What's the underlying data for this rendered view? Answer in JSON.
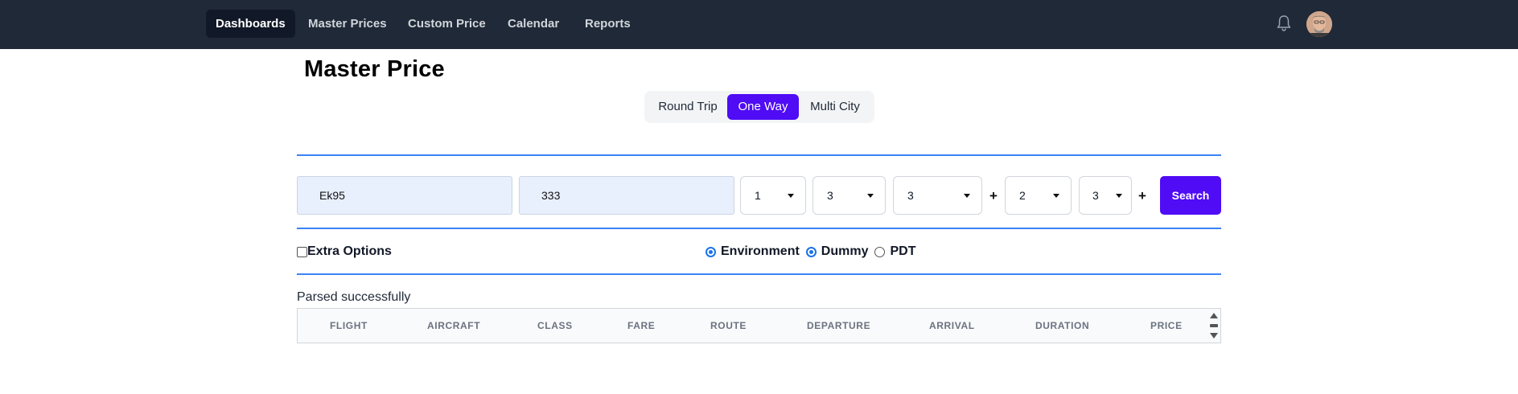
{
  "nav": {
    "items": [
      {
        "label": "Dashboards",
        "active": true
      },
      {
        "label": "Master Prices",
        "active": false
      },
      {
        "label": "Custom Price",
        "active": false
      },
      {
        "label": "Calendar",
        "active": false
      },
      {
        "label": "Reports",
        "active": false
      }
    ],
    "icons": [
      "bell-icon",
      "avatar"
    ]
  },
  "page": {
    "title": "Master Price"
  },
  "trip_type": {
    "options": [
      "Round Trip",
      "One Way",
      "Multi City"
    ],
    "selected": "One Way"
  },
  "search": {
    "field1_value": "Ek95",
    "field2_value": "333",
    "select1": "1",
    "select2": "3",
    "select3": "3",
    "plus1": "+",
    "select4": "2",
    "select5": "3",
    "plus2": "+",
    "button_label": "Search"
  },
  "options": {
    "extra_label": "Extra Options",
    "extra_checked": false,
    "radios": [
      {
        "label": "Environment",
        "checked": true
      },
      {
        "label": "Dummy",
        "checked": true
      },
      {
        "label": "PDT",
        "checked": false
      }
    ]
  },
  "status": {
    "message": "Parsed successfully"
  },
  "table": {
    "columns": [
      "FLIGHT",
      "AIRCRAFT",
      "CLASS",
      "FARE",
      "ROUTE",
      "DEPARTURE",
      "ARRIVAL",
      "DURATION",
      "PRICE"
    ],
    "rows": []
  },
  "colors": {
    "nav_bg": "#1f2937",
    "accent": "#4f0cf5",
    "divider": "#3b82f6",
    "input_bg": "#e8effd"
  }
}
